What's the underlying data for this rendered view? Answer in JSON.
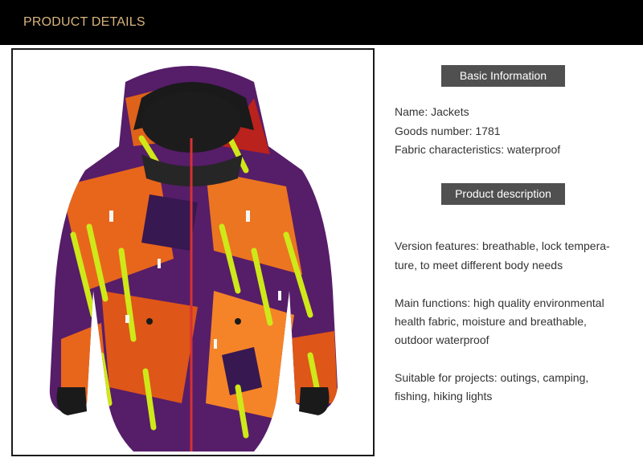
{
  "header": {
    "title": "PRODUCT DETAILS"
  },
  "product_image": {
    "alt": "Jacket"
  },
  "basic_info": {
    "heading": "Basic Information",
    "name": "Name: Jackets",
    "goods_number": "Goods number: 1781",
    "fabric": "Fabric characteristics: waterproof"
  },
  "description": {
    "heading": "Product description",
    "version_features": [
      "Version features: breathable, lock tempera-",
      "ture, to meet different body needs"
    ],
    "main_functions": [
      "Main functions: high quality environmental",
      "health fabric, moisture and breathable,",
      "outdoor waterproof"
    ],
    "suitable_for": [
      "Suitable for projects: outings, camping,",
      "fishing, hiking lights"
    ]
  },
  "colors": {
    "header_bg": "#000000",
    "header_text": "#d9b57c",
    "badge_bg": "#505050"
  }
}
